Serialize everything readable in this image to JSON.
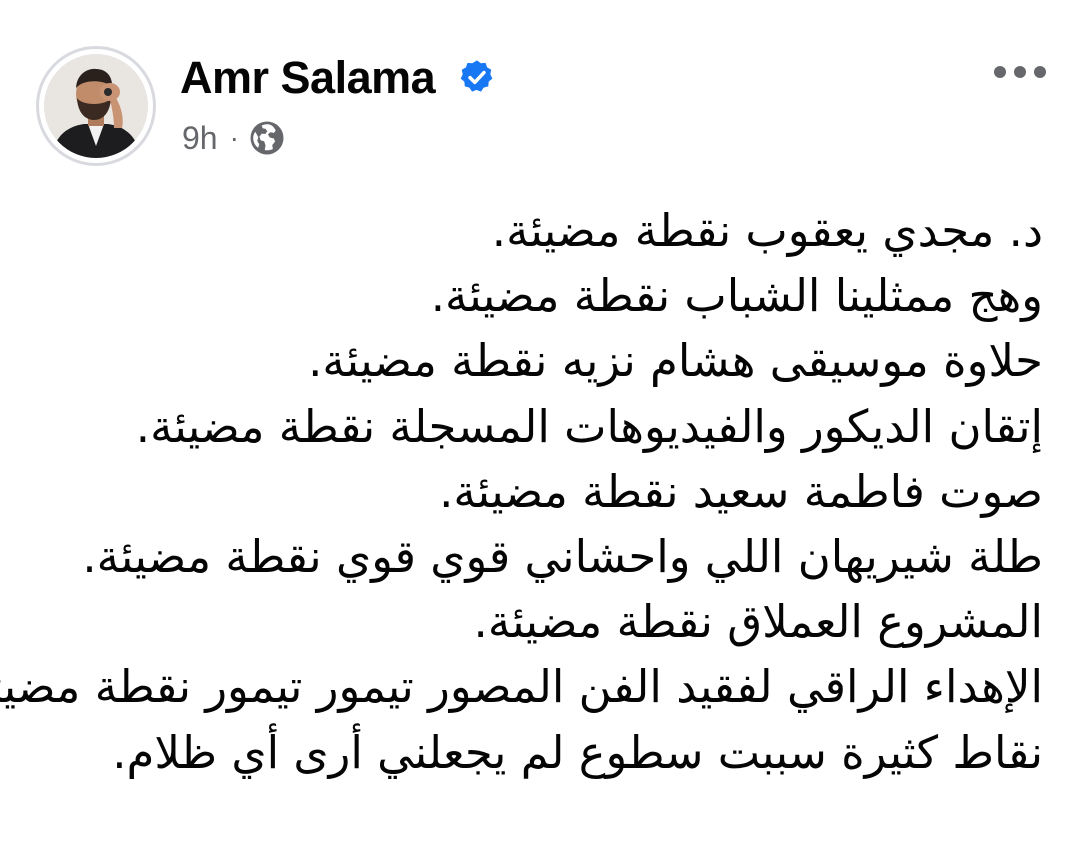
{
  "author": {
    "name": "Amr Salama",
    "verified": true,
    "time": "9h",
    "separator": "·",
    "audience_icon": "globe-icon"
  },
  "header": {
    "more_icon": "more-horizontal-icon"
  },
  "post": {
    "lines": [
      "د. مجدي يعقوب نقطة مضيئة.",
      "وهج ممثلينا الشباب نقطة مضيئة.",
      "حلاوة موسيقى هشام نزيه نقطة مضيئة.",
      "إتقان الديكور والفيديوهات المسجلة نقطة مضيئة.",
      "صوت فاطمة سعيد نقطة مضيئة.",
      "طلة شيريهان اللي واحشاني قوي قوي نقطة مضيئة.",
      "المشروع العملاق نقطة مضيئة.",
      "الإهداء الراقي لفقيد الفن المصور تيمور تيمور نقطة مضيئة.",
      "نقاط كثيرة سببت سطوع لم يجعلني أرى أي ظلام."
    ]
  },
  "colors": {
    "verified_blue": "#1877f2",
    "secondary_text": "#65676b",
    "primary_text": "#050505"
  }
}
